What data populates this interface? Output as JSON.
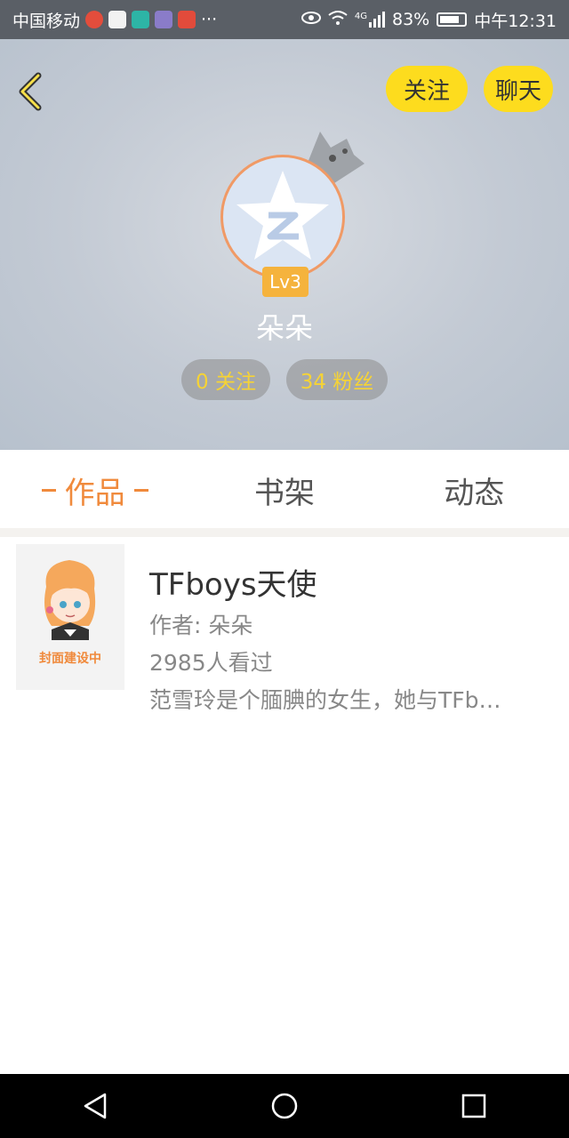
{
  "status_bar": {
    "carrier": "中国移动",
    "more": "···",
    "network": "4G",
    "battery": "83%",
    "time": "中午12:31"
  },
  "header": {
    "follow_button": "关注",
    "chat_button": "聊天",
    "level": "Lv3",
    "username": "朵朵",
    "following": "0 关注",
    "fans": "34 粉丝"
  },
  "tabs": [
    {
      "label": "作品",
      "active": true
    },
    {
      "label": "书架",
      "active": false
    },
    {
      "label": "动态",
      "active": false
    }
  ],
  "books": [
    {
      "title": "TFboys天使",
      "author": "作者: 朵朵",
      "views": "2985人看过",
      "description": "范雪玲是个腼腆的女生，她与TFb…",
      "cover_label": "封面建设中"
    }
  ],
  "colors": {
    "accent_orange": "#f08a3c",
    "button_yellow": "#fddc1e",
    "stat_text": "#f6d335"
  }
}
